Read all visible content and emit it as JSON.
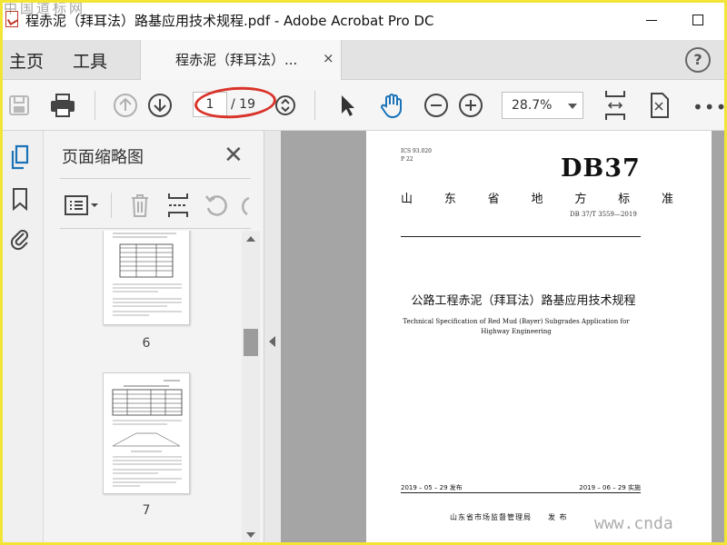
{
  "window": {
    "title": "程赤泥（拜耳法）路基应用技术规程.pdf - Adobe Acrobat Pro DC",
    "watermark_top": "中国道标网"
  },
  "nav": {
    "home": "主页",
    "tools": "工具",
    "tab_label": "程赤泥（拜耳法）...",
    "tab_close": "×",
    "help": "?"
  },
  "toolbar": {
    "current_page": "1",
    "page_total": "/ 19",
    "zoom": "28.7%",
    "more": "•••"
  },
  "panel": {
    "title": "页面缩略图",
    "close": "✕",
    "thumbnails": [
      {
        "label": "6"
      },
      {
        "label": "7"
      }
    ]
  },
  "document": {
    "ics": "ICS 93.020",
    "ccs": "P 22",
    "code": "DB37",
    "standard_chars": [
      "山",
      "东",
      "省",
      "地",
      "方",
      "标",
      "准"
    ],
    "number": "DB 37/T 3559—2019",
    "title_cn": "公路工程赤泥（拜耳法）路基应用技术规程",
    "title_en": "Technical Specification of Red Mud (Bayer) Subgrades Application for Highway Engineering",
    "issue_date": "2019 – 05 – 29 发布",
    "impl_date": "2019 – 06 – 29 实施",
    "issuer": "山东省市场监督管理局　　发 布"
  },
  "watermark_bottom": "www.cnda",
  "colors": {
    "frame": "#f2e535",
    "annotation": "#d9342b",
    "accent": "#1a73b8"
  }
}
